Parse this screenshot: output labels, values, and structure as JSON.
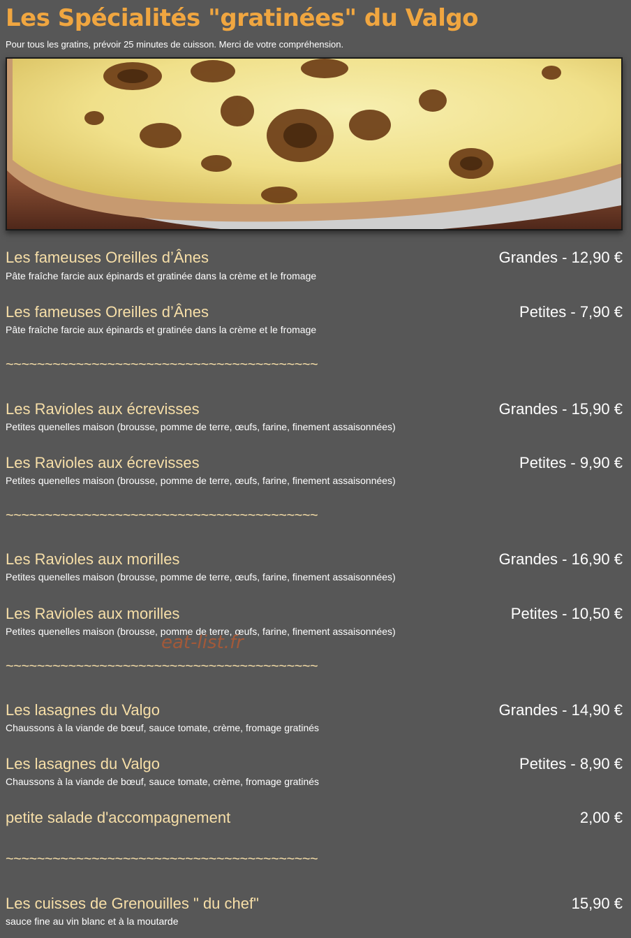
{
  "header": {
    "title": "Les Spécialités \"gratinées\" du Valgo",
    "subtitle": "Pour tous les gratins, prévoir 25 minutes de cuisson. Merci de votre compréhension."
  },
  "photo": {
    "alt": "gratin-photo"
  },
  "items": [
    {
      "name": "Les fameuses Oreilles d’Ânes",
      "price": "Grandes - 12,90 €",
      "desc": "Pâte fraîche farcie aux épinards et gratinée dans la crème et le fromage"
    },
    {
      "name": "Les fameuses Oreilles d’Ânes",
      "price": "Petites - 7,90 €",
      "desc": "Pâte fraîche farcie aux épinards et gratinée dans la crème et le fromage"
    },
    {
      "name": "Les Ravioles aux écrevisses",
      "price": "Grandes - 15,90 €",
      "desc": "Petites quenelles maison (brousse, pomme de terre, œufs, farine, finement assaisonnées)"
    },
    {
      "name": "Les Ravioles aux écrevisses",
      "price": "Petites - 9,90 €",
      "desc": "Petites quenelles maison (brousse, pomme de terre, œufs, farine, finement assaisonnées)"
    },
    {
      "name": "Les Ravioles aux morilles",
      "price": "Grandes - 16,90 €",
      "desc": "Petites quenelles maison (brousse, pomme de terre, œufs, farine, finement assaisonnées)"
    },
    {
      "name": "Les Ravioles aux morilles",
      "price": "Petites - 10,50 €",
      "desc": "Petites quenelles maison (brousse, pomme de terre, œufs, farine, finement assaisonnées)"
    },
    {
      "name": "Les lasagnes du Valgo",
      "price": "Grandes - 14,90 €",
      "desc": "Chaussons à la viande de bœuf, sauce tomate, crème, fromage gratinés"
    },
    {
      "name": "Les lasagnes du Valgo",
      "price": "Petites - 8,90 €",
      "desc": "Chaussons à la viande de bœuf, sauce tomate, crème, fromage gratinés"
    },
    {
      "name": "petite salade d'accompagnement",
      "price": "2,00 €",
      "desc": ""
    },
    {
      "name": "Les cuisses de Grenouilles \" du chef\"",
      "price": "15,90 €",
      "desc": "sauce fine au vin blanc et à la moutarde"
    }
  ],
  "separator": "~~~~~~~~~~~~~~~~~~~~~~~~~~~~~~~~~~~~~~~~",
  "watermark": "eat-list.fr"
}
